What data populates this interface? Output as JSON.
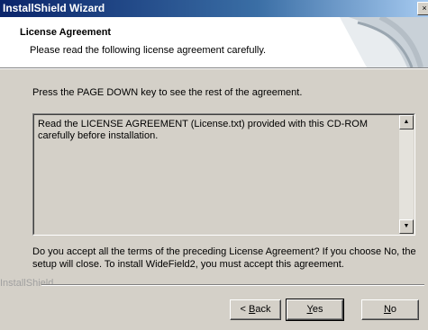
{
  "window": {
    "title": "InstallShield Wizard",
    "close_glyph": "×"
  },
  "header": {
    "title": "License Agreement",
    "subtitle": "Please read the following license agreement carefully."
  },
  "instruction": "Press the PAGE DOWN key to see the rest of the agreement.",
  "license": {
    "line1": "Read the LICENSE AGREEMENT (License.txt) provided with this CD-ROM",
    "line2": "carefully before installation."
  },
  "question": {
    "line1": "Do you accept all the terms of the preceding License Agreement?  If you choose No,  the",
    "line2": "setup will close.  To install WideField2, you must accept this agreement."
  },
  "branding": "InstallShield",
  "buttons": {
    "back": {
      "prefix": "< ",
      "mnemonic": "B",
      "rest": "ack"
    },
    "yes": {
      "mnemonic": "Y",
      "rest": "es"
    },
    "no": {
      "mnemonic": "N",
      "rest": "o"
    }
  }
}
